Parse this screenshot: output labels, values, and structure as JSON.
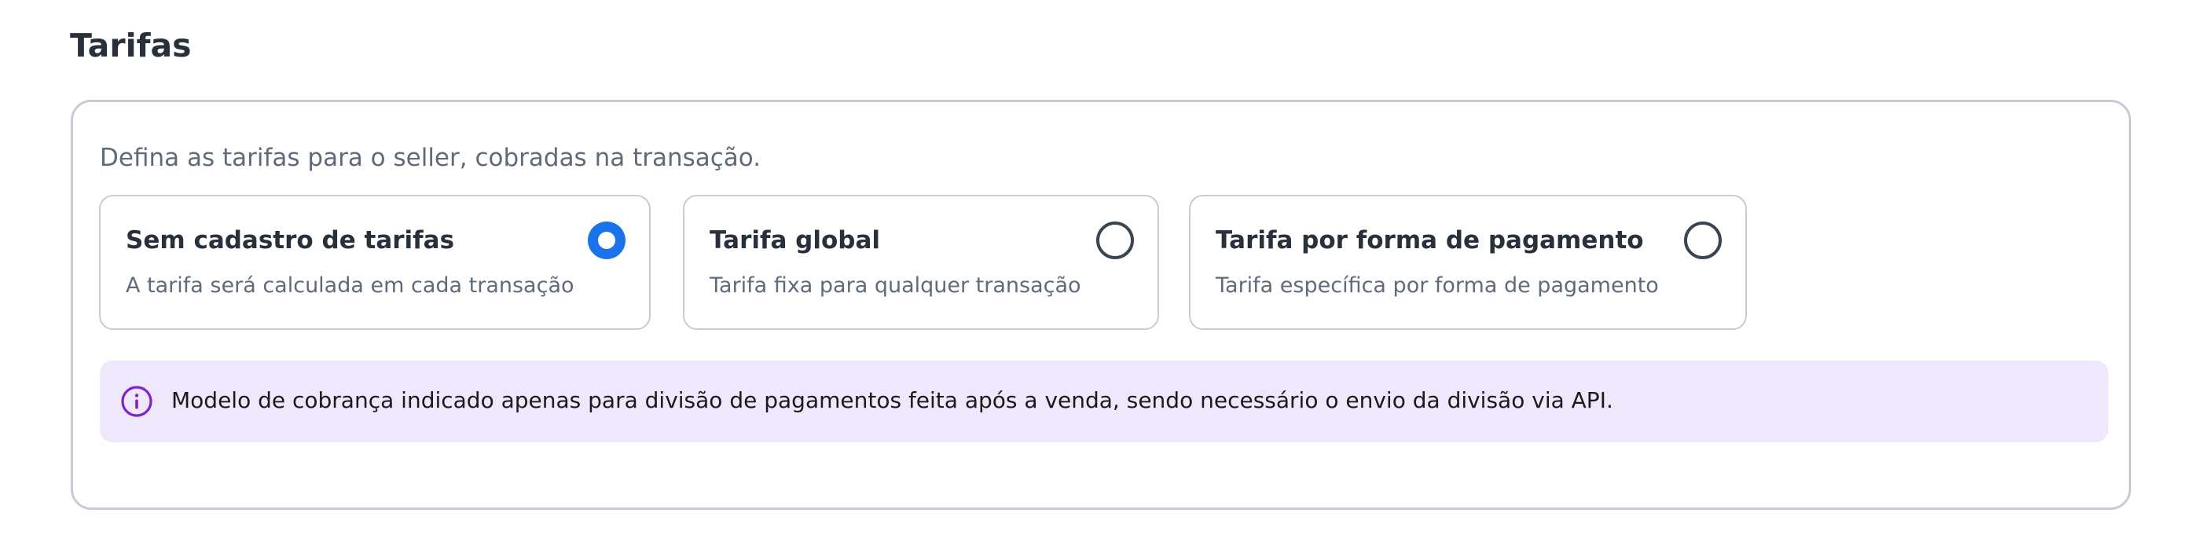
{
  "section": {
    "title": "Tarifas"
  },
  "card": {
    "description": "Defina as tarifas para o seller, cobradas na transação.",
    "options": [
      {
        "title": "Sem cadastro de tarifas",
        "description": "A tarifa será calculada em cada transação",
        "selected": true
      },
      {
        "title": "Tarifa global",
        "description": "Tarifa fixa para qualquer transação",
        "selected": false
      },
      {
        "title": "Tarifa por forma de pagamento",
        "description": "Tarifa específica por forma de pagamento",
        "selected": false
      }
    ],
    "info": {
      "icon": "info-icon",
      "text": "Modelo de cobrança indicado apenas para divisão de pagamentos feita após a venda, sendo necessário o envio da divisão via API."
    }
  },
  "colors": {
    "accent": "#1a73e8",
    "info_background": "#efe8fc",
    "info_icon": "#7e22ce",
    "border": "#c5ccd6"
  }
}
